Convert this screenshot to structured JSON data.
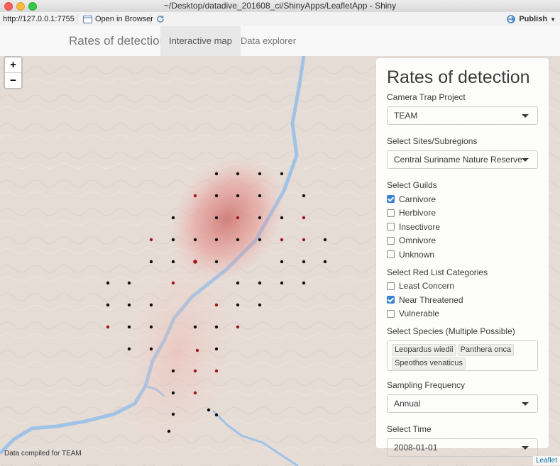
{
  "window": {
    "title": "~/Desktop/datadive_201608_ci/ShinyApps/LeafletApp - Shiny"
  },
  "toolbar": {
    "url": "http://127.0.0.1:7755",
    "open_browser_label": "Open in Browser",
    "publish_label": "Publish"
  },
  "navbar": {
    "brand": "Rates of detection",
    "tabs": [
      {
        "label": "Interactive map",
        "active": true
      },
      {
        "label": "Data explorer",
        "active": false
      }
    ]
  },
  "map": {
    "zoom_in": "+",
    "zoom_out": "−",
    "attribution_left": "Data compiled for TEAM",
    "attribution_right": "Leaflet",
    "colors": {
      "terrain": "#e6dcd6",
      "river": "#9fc3e6",
      "heat": "#d9534f",
      "point_black": "#111111",
      "point_red": "#a0151c"
    }
  },
  "panel": {
    "title": "Rates of detection",
    "project": {
      "label": "Camera Trap Project",
      "value": "TEAM"
    },
    "site": {
      "label": "Select Sites/Subregions",
      "value": "Central Suriname Nature Reserve"
    },
    "guilds": {
      "label": "Select Guilds",
      "options": [
        {
          "label": "Carnivore",
          "checked": true
        },
        {
          "label": "Herbivore",
          "checked": false
        },
        {
          "label": "Insectivore",
          "checked": false
        },
        {
          "label": "Omnivore",
          "checked": false
        },
        {
          "label": "Unknown",
          "checked": false
        }
      ]
    },
    "redlist": {
      "label": "Select Red List Categories",
      "options": [
        {
          "label": "Least Concern",
          "checked": false
        },
        {
          "label": "Near Threatened",
          "checked": true
        },
        {
          "label": "Vulnerable",
          "checked": false
        }
      ]
    },
    "species": {
      "label": "Select Species (Multiple Possible)",
      "selected": [
        "Leopardus wiedii",
        "Panthera onca",
        "Speothos venaticus"
      ]
    },
    "frequency": {
      "label": "Sampling Frequency",
      "value": "Annual"
    },
    "time": {
      "label": "Select Time",
      "value": "2008-01-01"
    }
  }
}
